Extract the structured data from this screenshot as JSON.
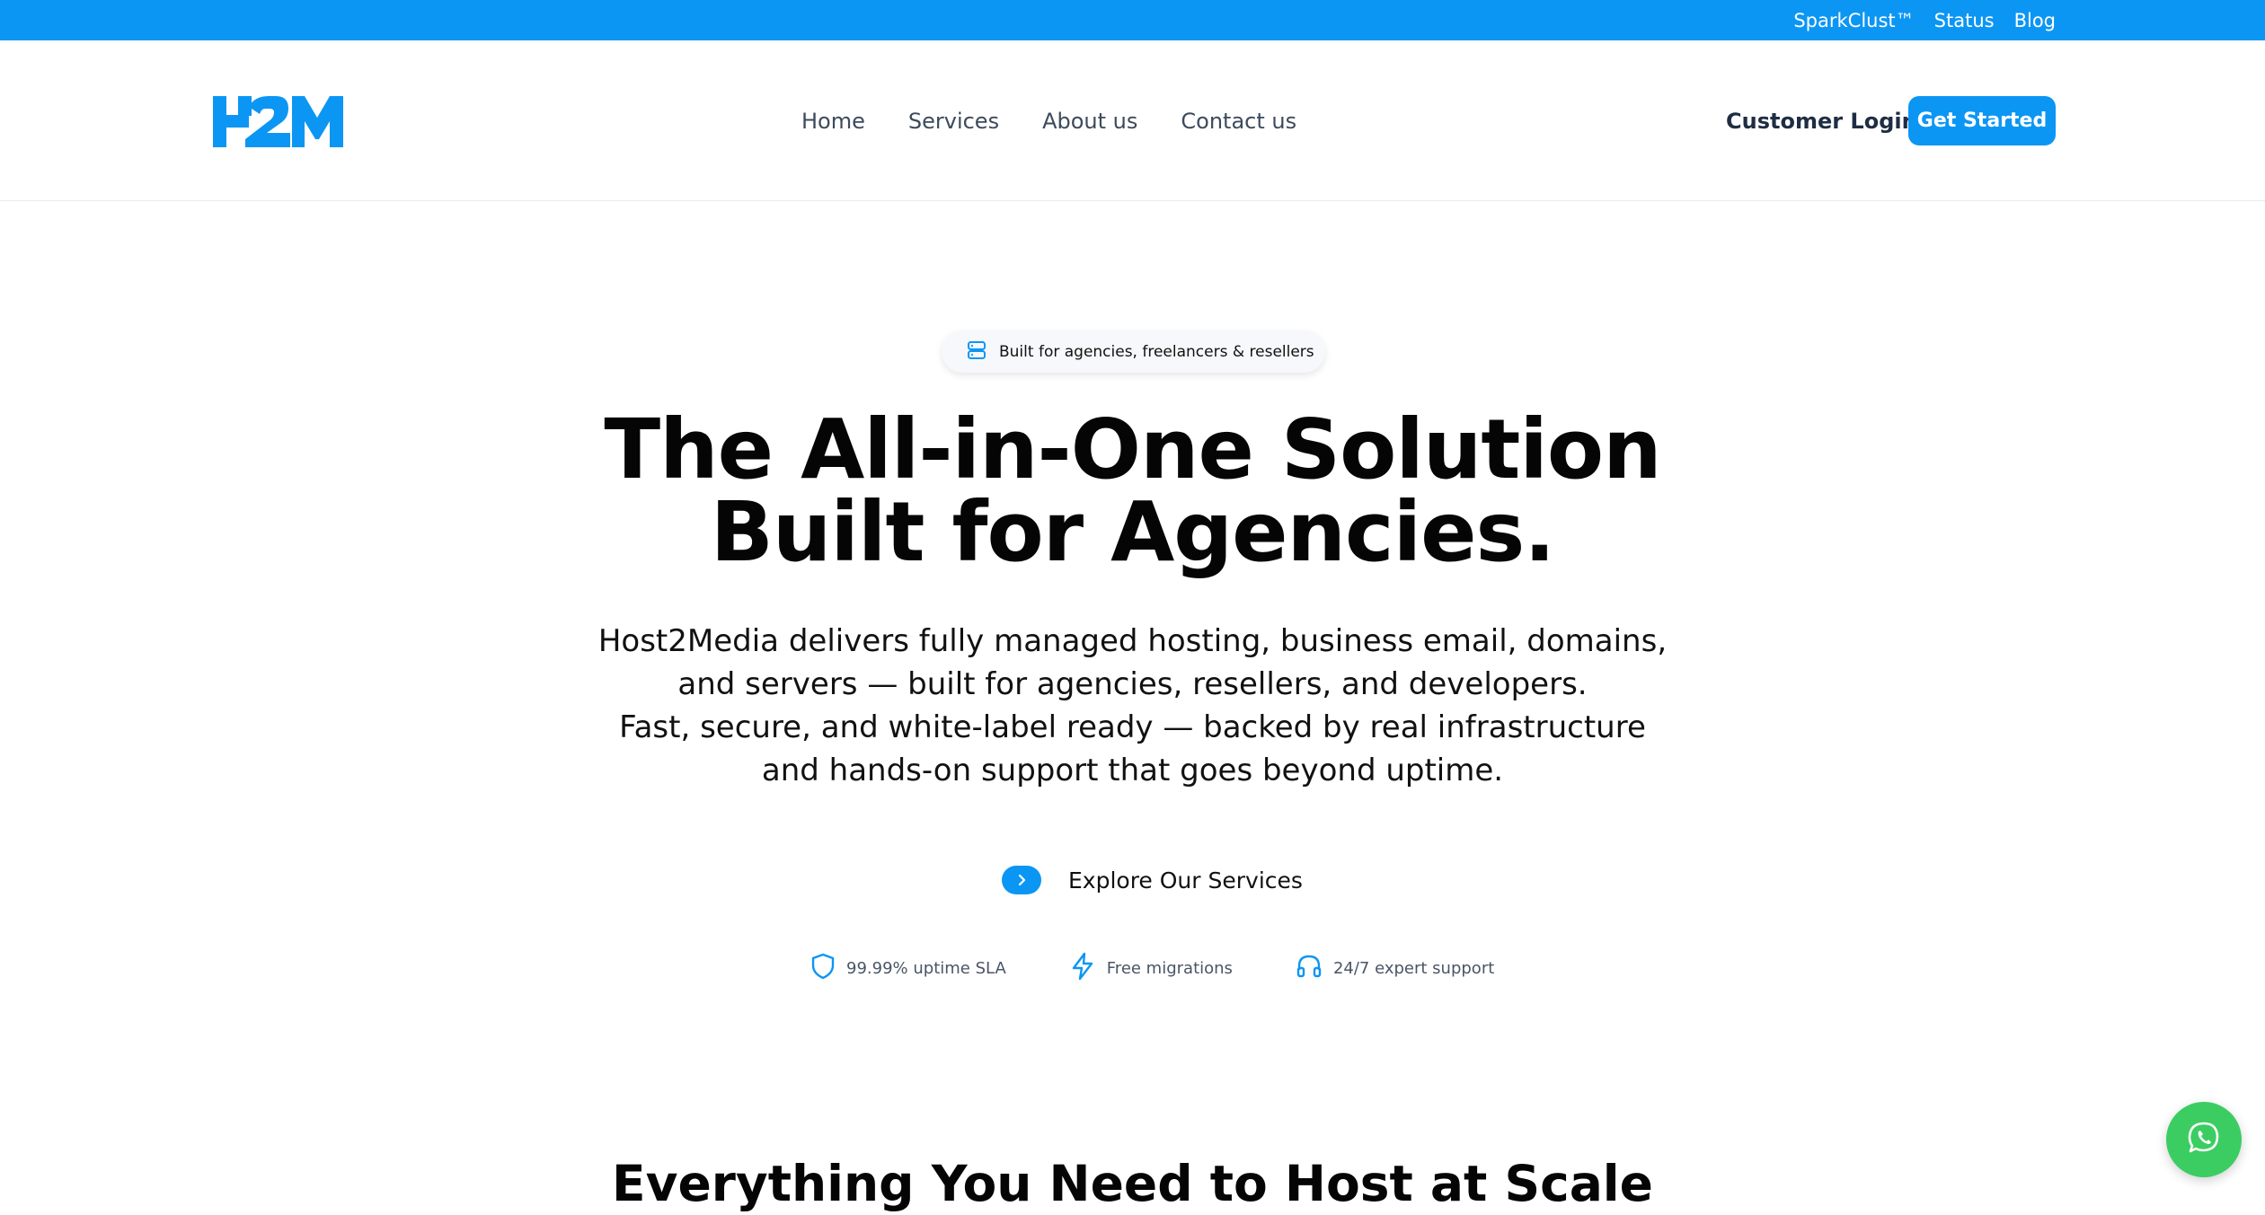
{
  "topbar": {
    "links": [
      "SparkClust™",
      "Status",
      "Blog"
    ]
  },
  "header": {
    "logo_text": "H2M",
    "nav": [
      "Home",
      "Services",
      "About us",
      "Contact us"
    ],
    "login_label": "Customer Login",
    "cta_label": "Get Started"
  },
  "hero": {
    "badge_icon": "server-icon",
    "badge_text": "Built for agencies, freelancers & resellers",
    "title_lines": [
      "The All-in-One Solution",
      "Built for Agencies."
    ],
    "subtitle_lines": [
      "Host2Media delivers fully managed hosting, business email, domains,",
      "and servers — built for agencies, resellers, and developers.",
      "Fast, secure, and white-label ready — backed by real infrastructure",
      "and hands-on support that goes beyond uptime."
    ],
    "explore_label": "Explore Our Services",
    "features": [
      {
        "icon": "shield-icon",
        "label": "99.99% uptime SLA"
      },
      {
        "icon": "lightning-icon",
        "label": "Free migrations"
      },
      {
        "icon": "headphones-icon",
        "label": "24/7 expert support"
      }
    ]
  },
  "section": {
    "title": "Everything You Need to Host at Scale"
  },
  "colors": {
    "brand_blue": "#0c96f4",
    "whatsapp_green": "#3ccd62",
    "nav_text": "#3d4a5c"
  }
}
